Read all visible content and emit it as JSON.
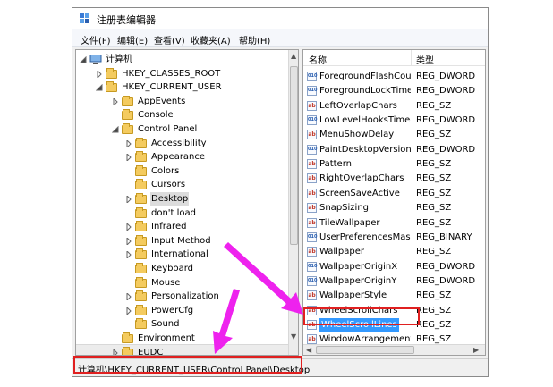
{
  "window": {
    "title": "注册表编辑器"
  },
  "menu": [
    "文件(F)",
    "编辑(E)",
    "查看(V)",
    "收藏夹(A)",
    "帮助(H)"
  ],
  "tree": [
    {
      "label": "计算机",
      "indent": 0,
      "expander": "open",
      "icon": "computer"
    },
    {
      "label": "HKEY_CLASSES_ROOT",
      "indent": 1,
      "expander": "closed",
      "icon": "folder"
    },
    {
      "label": "HKEY_CURRENT_USER",
      "indent": 1,
      "expander": "open",
      "icon": "folder"
    },
    {
      "label": "AppEvents",
      "indent": 2,
      "expander": "closed",
      "icon": "folder"
    },
    {
      "label": "Console",
      "indent": 2,
      "expander": "none",
      "icon": "folder"
    },
    {
      "label": "Control Panel",
      "indent": 2,
      "expander": "open",
      "icon": "folder"
    },
    {
      "label": "Accessibility",
      "indent": 3,
      "expander": "closed",
      "icon": "folder"
    },
    {
      "label": "Appearance",
      "indent": 3,
      "expander": "closed",
      "icon": "folder"
    },
    {
      "label": "Colors",
      "indent": 3,
      "expander": "none",
      "icon": "folder"
    },
    {
      "label": "Cursors",
      "indent": 3,
      "expander": "none",
      "icon": "folder"
    },
    {
      "label": "Desktop",
      "indent": 3,
      "expander": "closed",
      "icon": "folder",
      "selected": true
    },
    {
      "label": "don't load",
      "indent": 3,
      "expander": "none",
      "icon": "folder"
    },
    {
      "label": "Infrared",
      "indent": 3,
      "expander": "closed",
      "icon": "folder"
    },
    {
      "label": "Input Method",
      "indent": 3,
      "expander": "closed",
      "icon": "folder"
    },
    {
      "label": "International",
      "indent": 3,
      "expander": "closed",
      "icon": "folder"
    },
    {
      "label": "Keyboard",
      "indent": 3,
      "expander": "none",
      "icon": "folder"
    },
    {
      "label": "Mouse",
      "indent": 3,
      "expander": "none",
      "icon": "folder"
    },
    {
      "label": "Personalization",
      "indent": 3,
      "expander": "closed",
      "icon": "folder"
    },
    {
      "label": "PowerCfg",
      "indent": 3,
      "expander": "closed",
      "icon": "folder"
    },
    {
      "label": "Sound",
      "indent": 3,
      "expander": "none",
      "icon": "folder"
    },
    {
      "label": "Environment",
      "indent": 2,
      "expander": "none",
      "icon": "folder"
    },
    {
      "label": "EUDC",
      "indent": 2,
      "expander": "closed",
      "icon": "folder"
    }
  ],
  "list": {
    "header_name": "名称",
    "header_type": "类型",
    "rows": [
      {
        "name": "ForegroundFlashCount",
        "type": "REG_DWORD",
        "icon": "binary"
      },
      {
        "name": "ForegroundLockTime...",
        "type": "REG_DWORD",
        "icon": "binary"
      },
      {
        "name": "LeftOverlapChars",
        "type": "REG_SZ",
        "icon": "string"
      },
      {
        "name": "LowLevelHooksTimeo...",
        "type": "REG_DWORD",
        "icon": "binary"
      },
      {
        "name": "MenuShowDelay",
        "type": "REG_SZ",
        "icon": "string"
      },
      {
        "name": "PaintDesktopVersion",
        "type": "REG_DWORD",
        "icon": "binary"
      },
      {
        "name": "Pattern",
        "type": "REG_SZ",
        "icon": "string"
      },
      {
        "name": "RightOverlapChars",
        "type": "REG_SZ",
        "icon": "string"
      },
      {
        "name": "ScreenSaveActive",
        "type": "REG_SZ",
        "icon": "string"
      },
      {
        "name": "SnapSizing",
        "type": "REG_SZ",
        "icon": "string"
      },
      {
        "name": "TileWallpaper",
        "type": "REG_SZ",
        "icon": "string"
      },
      {
        "name": "UserPreferencesMask",
        "type": "REG_BINARY",
        "icon": "binary"
      },
      {
        "name": "Wallpaper",
        "type": "REG_SZ",
        "icon": "string"
      },
      {
        "name": "WallpaperOriginX",
        "type": "REG_DWORD",
        "icon": "binary"
      },
      {
        "name": "WallpaperOriginY",
        "type": "REG_DWORD",
        "icon": "binary"
      },
      {
        "name": "WallpaperStyle",
        "type": "REG_SZ",
        "icon": "string"
      },
      {
        "name": "WheelScrollChars",
        "type": "REG_SZ",
        "icon": "string"
      },
      {
        "name": "WheelScrollLines",
        "type": "REG_SZ",
        "icon": "string",
        "selected": true
      },
      {
        "name": "WindowArrangement...",
        "type": "REG_SZ",
        "icon": "string"
      }
    ]
  },
  "statusbar": {
    "path": "计算机\\HKEY_CURRENT_USER\\Control Panel\\Desktop"
  },
  "colors": {
    "highlight": "#e02020",
    "arrow": "#ee22ee",
    "selection": "#3399ff"
  }
}
